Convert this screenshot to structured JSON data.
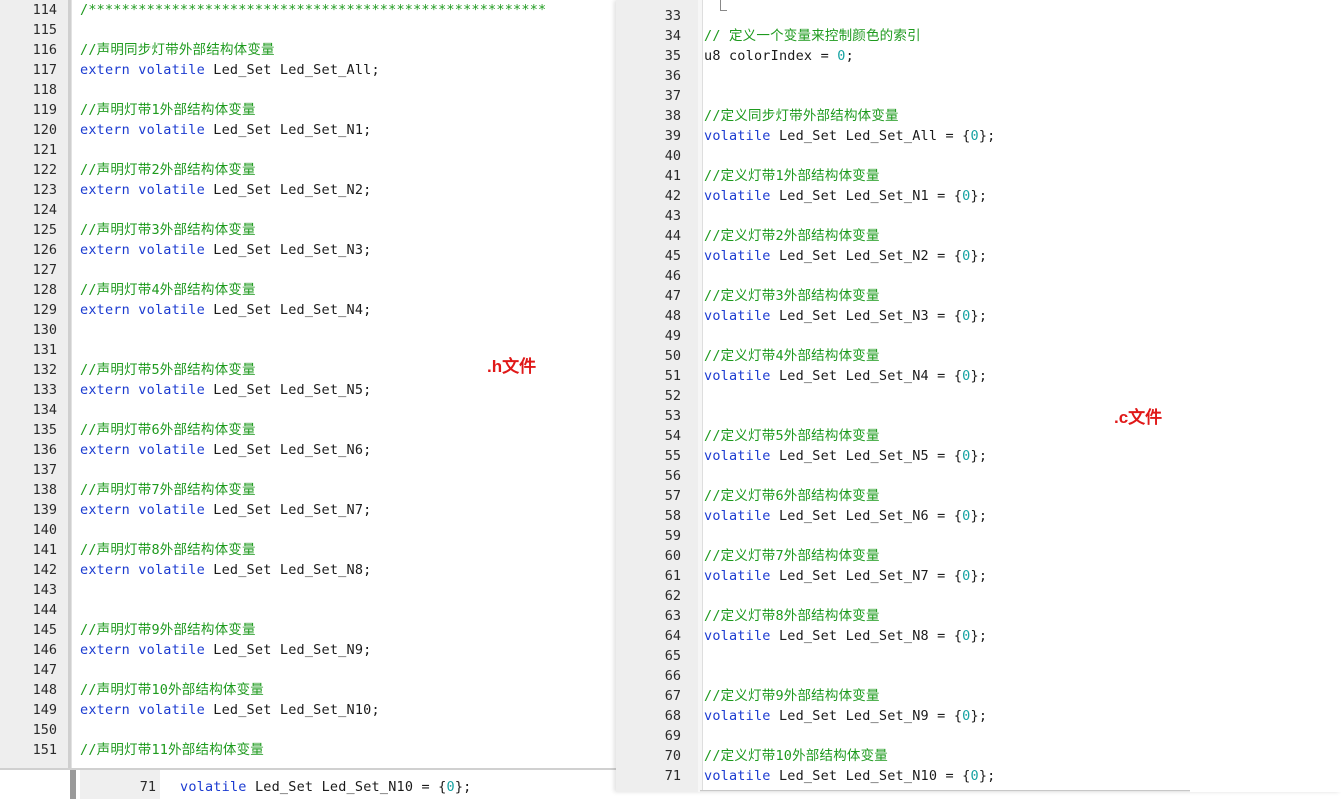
{
  "colors": {
    "comment": "#1e9a1e",
    "keyword": "#1b3bd1",
    "number": "#17a3a3",
    "annotation": "#e01818",
    "gutter_bg": "#eeeeee"
  },
  "left_editor": {
    "banner": "/*******************************************************",
    "lines": [
      {
        "n": "114",
        "kind": "banner",
        "text": ""
      },
      {
        "n": "115",
        "kind": "blank",
        "text": ""
      },
      {
        "n": "116",
        "kind": "comment",
        "text": "//声明同步灯带外部结构体变量"
      },
      {
        "n": "117",
        "kind": "extern",
        "text": "Led_Set Led_Set_All;"
      },
      {
        "n": "118",
        "kind": "blank",
        "text": ""
      },
      {
        "n": "119",
        "kind": "comment",
        "text": "//声明灯带1外部结构体变量"
      },
      {
        "n": "120",
        "kind": "extern",
        "text": "Led_Set Led_Set_N1;"
      },
      {
        "n": "121",
        "kind": "blank",
        "text": ""
      },
      {
        "n": "122",
        "kind": "comment",
        "text": "//声明灯带2外部结构体变量"
      },
      {
        "n": "123",
        "kind": "extern",
        "text": "Led_Set Led_Set_N2;"
      },
      {
        "n": "124",
        "kind": "blank",
        "text": ""
      },
      {
        "n": "125",
        "kind": "comment",
        "text": "//声明灯带3外部结构体变量"
      },
      {
        "n": "126",
        "kind": "extern",
        "text": "Led_Set Led_Set_N3;"
      },
      {
        "n": "127",
        "kind": "blank",
        "text": ""
      },
      {
        "n": "128",
        "kind": "comment",
        "text": "//声明灯带4外部结构体变量"
      },
      {
        "n": "129",
        "kind": "extern",
        "text": "Led_Set Led_Set_N4;"
      },
      {
        "n": "130",
        "kind": "blank",
        "text": ""
      },
      {
        "n": "131",
        "kind": "blank",
        "text": ""
      },
      {
        "n": "132",
        "kind": "comment",
        "text": "//声明灯带5外部结构体变量"
      },
      {
        "n": "133",
        "kind": "extern",
        "text": "Led_Set Led_Set_N5;"
      },
      {
        "n": "134",
        "kind": "blank",
        "text": ""
      },
      {
        "n": "135",
        "kind": "comment",
        "text": "//声明灯带6外部结构体变量"
      },
      {
        "n": "136",
        "kind": "extern",
        "text": "Led_Set Led_Set_N6;"
      },
      {
        "n": "137",
        "kind": "blank",
        "text": ""
      },
      {
        "n": "138",
        "kind": "comment",
        "text": "//声明灯带7外部结构体变量"
      },
      {
        "n": "139",
        "kind": "extern",
        "text": "Led_Set Led_Set_N7;"
      },
      {
        "n": "140",
        "kind": "blank",
        "text": ""
      },
      {
        "n": "141",
        "kind": "comment",
        "text": "//声明灯带8外部结构体变量"
      },
      {
        "n": "142",
        "kind": "extern",
        "text": "Led_Set Led_Set_N8;"
      },
      {
        "n": "143",
        "kind": "blank",
        "text": ""
      },
      {
        "n": "144",
        "kind": "blank",
        "text": ""
      },
      {
        "n": "145",
        "kind": "comment",
        "text": "//声明灯带9外部结构体变量"
      },
      {
        "n": "146",
        "kind": "extern",
        "text": "Led_Set Led_Set_N9;"
      },
      {
        "n": "147",
        "kind": "blank",
        "text": ""
      },
      {
        "n": "148",
        "kind": "comment",
        "text": "//声明灯带10外部结构体变量"
      },
      {
        "n": "149",
        "kind": "extern",
        "text": "Led_Set Led_Set_N10;"
      },
      {
        "n": "150",
        "kind": "blank",
        "text": ""
      },
      {
        "n": "151",
        "kind": "comment",
        "text": "//声明灯带11外部结构体变量"
      }
    ],
    "annotation": ".h文件"
  },
  "bottom_strip": {
    "line_number": "71",
    "code_prefix": "volatile Led_Set Led_Set_N10 = {",
    "code_value": "0",
    "code_suffix": "};"
  },
  "right_editor": {
    "lines": [
      {
        "n": "33",
        "kind": "blank",
        "text": ""
      },
      {
        "n": "34",
        "kind": "comment",
        "text": "// 定义一个变量来控制颜色的索引"
      },
      {
        "n": "35",
        "kind": "u8",
        "text": "u8 colorIndex = ",
        "val": "0",
        "suffix": ";"
      },
      {
        "n": "36",
        "kind": "blank",
        "text": ""
      },
      {
        "n": "37",
        "kind": "blank",
        "text": ""
      },
      {
        "n": "38",
        "kind": "comment",
        "text": "//定义同步灯带外部结构体变量"
      },
      {
        "n": "39",
        "kind": "vol",
        "text": "Led_Set Led_Set_All = {",
        "val": "0",
        "suffix": "};"
      },
      {
        "n": "40",
        "kind": "blank",
        "text": ""
      },
      {
        "n": "41",
        "kind": "comment",
        "text": "//定义灯带1外部结构体变量"
      },
      {
        "n": "42",
        "kind": "vol",
        "text": "Led_Set Led_Set_N1 = {",
        "val": "0",
        "suffix": "};"
      },
      {
        "n": "43",
        "kind": "blank",
        "text": ""
      },
      {
        "n": "44",
        "kind": "comment",
        "text": "//定义灯带2外部结构体变量"
      },
      {
        "n": "45",
        "kind": "vol",
        "text": "Led_Set Led_Set_N2 = {",
        "val": "0",
        "suffix": "};"
      },
      {
        "n": "46",
        "kind": "blank",
        "text": ""
      },
      {
        "n": "47",
        "kind": "comment",
        "text": "//定义灯带3外部结构体变量"
      },
      {
        "n": "48",
        "kind": "vol",
        "text": "Led_Set Led_Set_N3 = {",
        "val": "0",
        "suffix": "};"
      },
      {
        "n": "49",
        "kind": "blank",
        "text": ""
      },
      {
        "n": "50",
        "kind": "comment",
        "text": "//定义灯带4外部结构体变量"
      },
      {
        "n": "51",
        "kind": "vol",
        "text": "Led_Set Led_Set_N4 = {",
        "val": "0",
        "suffix": "};"
      },
      {
        "n": "52",
        "kind": "blank",
        "text": ""
      },
      {
        "n": "53",
        "kind": "blank",
        "text": ""
      },
      {
        "n": "54",
        "kind": "comment",
        "text": "//定义灯带5外部结构体变量"
      },
      {
        "n": "55",
        "kind": "vol",
        "text": "Led_Set Led_Set_N5 = {",
        "val": "0",
        "suffix": "};"
      },
      {
        "n": "56",
        "kind": "blank",
        "text": ""
      },
      {
        "n": "57",
        "kind": "comment",
        "text": "//定义灯带6外部结构体变量"
      },
      {
        "n": "58",
        "kind": "vol",
        "text": "Led_Set Led_Set_N6 = {",
        "val": "0",
        "suffix": "};"
      },
      {
        "n": "59",
        "kind": "blank",
        "text": ""
      },
      {
        "n": "60",
        "kind": "comment",
        "text": "//定义灯带7外部结构体变量"
      },
      {
        "n": "61",
        "kind": "vol",
        "text": "Led_Set Led_Set_N7 = {",
        "val": "0",
        "suffix": "};"
      },
      {
        "n": "62",
        "kind": "blank",
        "text": ""
      },
      {
        "n": "63",
        "kind": "comment",
        "text": "//定义灯带8外部结构体变量"
      },
      {
        "n": "64",
        "kind": "vol",
        "text": "Led_Set Led_Set_N8 = {",
        "val": "0",
        "suffix": "};"
      },
      {
        "n": "65",
        "kind": "blank",
        "text": ""
      },
      {
        "n": "66",
        "kind": "blank",
        "text": ""
      },
      {
        "n": "67",
        "kind": "comment",
        "text": "//定义灯带9外部结构体变量"
      },
      {
        "n": "68",
        "kind": "vol",
        "text": "Led_Set Led_Set_N9 = {",
        "val": "0",
        "suffix": "};"
      },
      {
        "n": "69",
        "kind": "blank",
        "text": ""
      },
      {
        "n": "70",
        "kind": "comment",
        "text": "//定义灯带10外部结构体变量"
      },
      {
        "n": "71",
        "kind": "vol",
        "text": "Led_Set Led_Set_N10 = {",
        "val": "0",
        "suffix": "};"
      }
    ],
    "annotation": ".c文件"
  },
  "keywords": {
    "extern": "extern",
    "volatile": "volatile"
  }
}
